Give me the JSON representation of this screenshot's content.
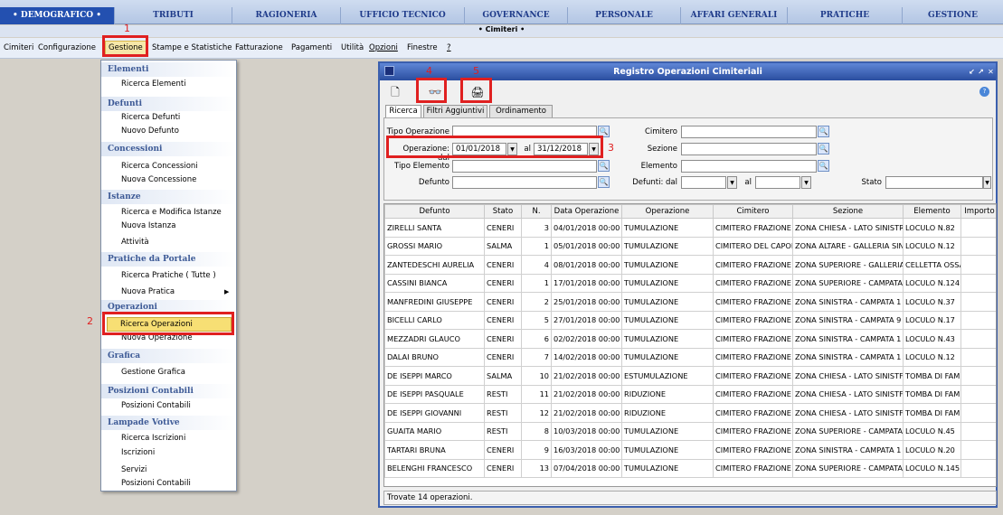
{
  "modules": [
    "• DEMOGRAFICO •",
    "TRIBUTI",
    "RAGIONERIA",
    "UFFICIO TECNICO",
    "GOVERNANCE",
    "PERSONALE",
    "AFFARI GENERALI",
    "PRATICHE",
    "GESTIONE"
  ],
  "submodule": "• Cimiteri •",
  "menubar": [
    "Cimiteri",
    "Configurazione",
    "Gestione",
    "Stampe e Statistiche",
    "Fatturazione",
    "Pagamenti",
    "Utilità",
    "Opzioni",
    "Finestre",
    "?"
  ],
  "annotations": [
    "1",
    "2",
    "3",
    "4",
    "5"
  ],
  "dropdown": {
    "sections": [
      "Elementi",
      "Defunti",
      "Concessioni",
      "Istanze",
      "Pratiche da Portale",
      "Operazioni",
      "Grafica",
      "Posizioni Contabili",
      "Lampade Votive"
    ],
    "items": [
      "Ricerca Elementi",
      "Ricerca Defunti",
      "Nuovo Defunto",
      "Ricerca Concessioni",
      "Nuova Concessione",
      "Ricerca e Modifica Istanze",
      "Nuova Istanza",
      "Attività",
      "Ricerca Pratiche ( Tutte )",
      "Nuova Pratica",
      "Ricerca Operazioni",
      "Nuova Operazione",
      "Gestione Grafica",
      "Posizioni Contabili",
      "Ricerca Iscrizioni",
      "Iscrizioni",
      "Servizi",
      "Posizioni Contabili"
    ],
    "submenu_arrow": "▶"
  },
  "window": {
    "title": "Registro Operazioni Cimiteriali",
    "buttons": [
      "↙",
      "↗",
      "✕"
    ],
    "help": "?"
  },
  "toolbar": {
    "new": "🗋",
    "search": "👓",
    "print": "🖨"
  },
  "tabs": [
    "Ricerca",
    "Filtri Aggiuntivi",
    "Ordinamento"
  ],
  "form": {
    "tipo_operazione": "Tipo Operazione",
    "operazione_dal": "Operazione: dal",
    "date_from": "01/01/2018",
    "al": "al",
    "date_to": "31/12/2018",
    "tipo_elemento": "Tipo Elemento",
    "defunto": "Defunto",
    "cimitero": "Cimitero",
    "sezione": "Sezione",
    "elemento": "Elemento",
    "defunti_dal": "Defunti: dal",
    "defunti_al": "al",
    "stato": "Stato"
  },
  "grid": {
    "columns": [
      "Defunto",
      "Stato",
      "N.",
      "Data Operazione",
      "Operazione",
      "Cimitero",
      "Sezione",
      "Elemento",
      "Importo"
    ],
    "rows": [
      [
        "ZIRELLI SANTA",
        "CENERI",
        "3",
        "04/01/2018 00:00",
        "TUMULAZIONE",
        "CIMITERO FRAZIONE",
        "ZONA CHIESA - LATO SINISTR",
        "LOCULO N.82",
        ""
      ],
      [
        "GROSSI MARIO",
        "SALMA",
        "1",
        "05/01/2018 00:00",
        "TUMULAZIONE",
        "CIMITERO DEL CAPOI",
        "ZONA ALTARE - GALLERIA SIN",
        "LOCULO N.12",
        ""
      ],
      [
        "ZANTEDESCHI AURELIA",
        "CENERI",
        "4",
        "08/01/2018 00:00",
        "TUMULAZIONE",
        "CIMITERO FRAZIONE",
        "ZONA SUPERIORE - GALLERIA",
        "CELLETTA OSSA",
        ""
      ],
      [
        "CASSINI BIANCA",
        "CENERI",
        "1",
        "17/01/2018 00:00",
        "TUMULAZIONE",
        "CIMITERO FRAZIONE",
        "ZONA SUPERIORE - CAMPATA",
        "LOCULO N.124",
        ""
      ],
      [
        "MANFREDINI GIUSEPPE",
        "CENERI",
        "2",
        "25/01/2018 00:00",
        "TUMULAZIONE",
        "CIMITERO FRAZIONE",
        "ZONA SINISTRA - CAMPATA 1",
        "LOCULO N.37",
        ""
      ],
      [
        "BICELLI CARLO",
        "CENERI",
        "5",
        "27/01/2018 00:00",
        "TUMULAZIONE",
        "CIMITERO FRAZIONE",
        "ZONA SINISTRA - CAMPATA 9",
        "LOCULO N.17",
        ""
      ],
      [
        "MEZZADRI GLAUCO",
        "CENERI",
        "6",
        "02/02/2018 00:00",
        "TUMULAZIONE",
        "CIMITERO FRAZIONE",
        "ZONA SINISTRA - CAMPATA 1",
        "LOCULO N.43",
        ""
      ],
      [
        "DALAI BRUNO",
        "CENERI",
        "7",
        "14/02/2018 00:00",
        "TUMULAZIONE",
        "CIMITERO FRAZIONE",
        "ZONA SINISTRA - CAMPATA 1",
        "LOCULO N.12",
        ""
      ],
      [
        "DE ISEPPI MARCO",
        "SALMA",
        "10",
        "21/02/2018 00:00",
        "ESTUMULAZIONE",
        "CIMITERO FRAZIONE",
        "ZONA CHIESA - LATO SINISTF",
        "TOMBA DI FAMI",
        ""
      ],
      [
        "DE ISEPPI PASQUALE",
        "RESTI",
        "11",
        "21/02/2018 00:00",
        "RIDUZIONE",
        "CIMITERO FRAZIONE",
        "ZONA CHIESA - LATO SINISTF",
        "TOMBA DI FAMI",
        ""
      ],
      [
        "DE ISEPPI GIOVANNI",
        "RESTI",
        "12",
        "21/02/2018 00:00",
        "RIDUZIONE",
        "CIMITERO FRAZIONE",
        "ZONA CHIESA - LATO SINISTF",
        "TOMBA DI FAMI",
        ""
      ],
      [
        "GUAITA MARIO",
        "RESTI",
        "8",
        "10/03/2018 00:00",
        "TUMULAZIONE",
        "CIMITERO FRAZIONE",
        "ZONA SUPERIORE - CAMPATA",
        "LOCULO N.45",
        ""
      ],
      [
        "TARTARI BRUNA",
        "CENERI",
        "9",
        "16/03/2018 00:00",
        "TUMULAZIONE",
        "CIMITERO FRAZIONE",
        "ZONA SINISTRA - CAMPATA 1",
        "LOCULO N.20",
        ""
      ],
      [
        "BELENGHI FRANCESCO",
        "CENERI",
        "13",
        "07/04/2018 00:00",
        "TUMULAZIONE",
        "CIMITERO FRAZIONE",
        "ZONA SUPERIORE - CAMPATA",
        "LOCULO N.145",
        ""
      ]
    ]
  },
  "status": "Trovate 14 operazioni."
}
